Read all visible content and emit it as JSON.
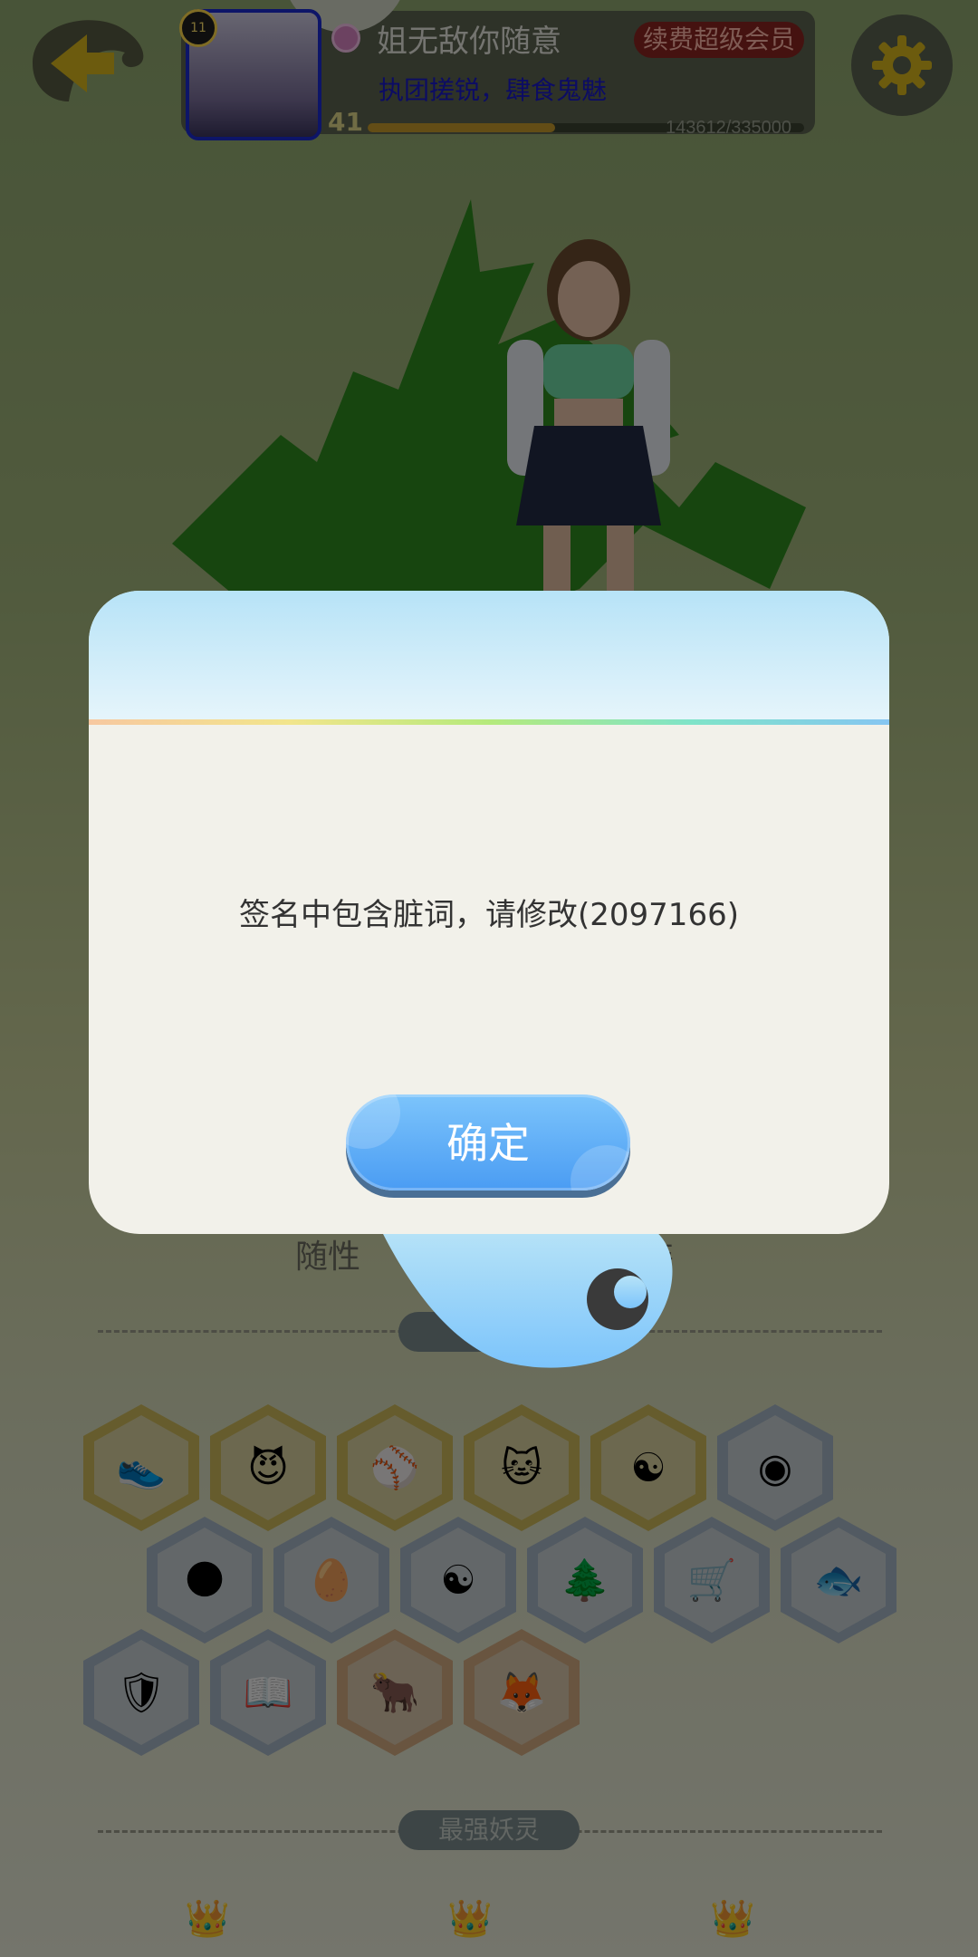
{
  "profile": {
    "rank": "11",
    "username": "姐无敌你随意",
    "vip_label": "续费超级会员",
    "motto": "执团搓锐，肆食鬼魅",
    "level": "41",
    "exp_text": "143612/335000",
    "exp_progress": 0.4287
  },
  "background": {
    "hidden_text_left": "随性",
    "hidden_text_right": "时装",
    "section_label": "最强妖灵"
  },
  "dialog": {
    "message": "签名中包含脏词，请修改(2097166)",
    "confirm_label": "确定"
  },
  "colors": {
    "dialog_header": "#b7e3f7",
    "confirm_button": "#5aa8f6",
    "overlay": "rgba(0,0,0,0.5)"
  },
  "icons": {
    "back": "back-arrow-icon",
    "settings": "gear-icon",
    "badges": [
      "sneaker-icon",
      "devil-cat-icon",
      "ball-icon",
      "cat-balloon-icon",
      "yinyang-icon",
      "portal-icon",
      "moon-icon",
      "egg-icon",
      "taiji-icon",
      "tree-icon",
      "cart-icon",
      "fish-icon",
      "shield-icon",
      "book-cat-icon",
      "bull-icon",
      "fox-icon"
    ]
  }
}
